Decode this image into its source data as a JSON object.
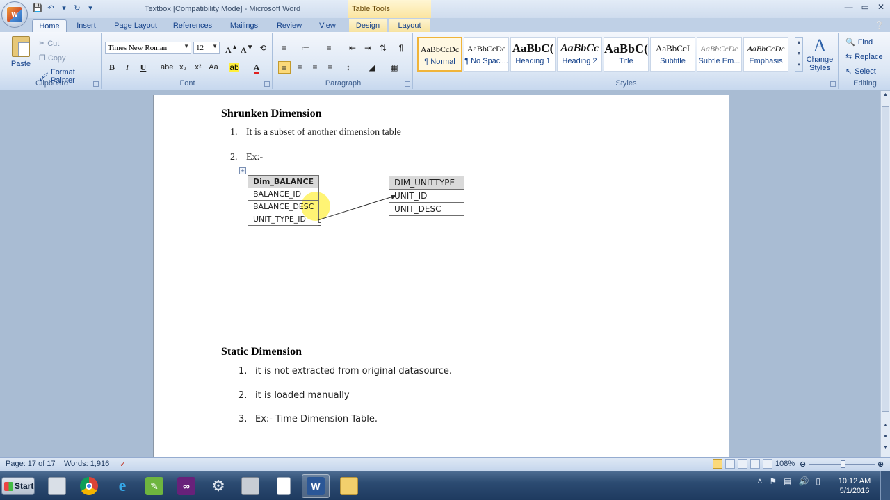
{
  "window": {
    "title": "Textbox [Compatibility Mode] - Microsoft Word",
    "contextual_tab_group": "Table Tools",
    "office_button_label": "W"
  },
  "tabs": [
    "Home",
    "Insert",
    "Page Layout",
    "References",
    "Mailings",
    "Review",
    "View",
    "Design",
    "Layout"
  ],
  "ribbon": {
    "clipboard": {
      "group_label": "Clipboard",
      "paste": "Paste",
      "cut": "Cut",
      "copy": "Copy",
      "format_painter": "Format Painter"
    },
    "font": {
      "group_label": "Font",
      "font_name": "Times New Roman",
      "font_size": "12",
      "bold": "B",
      "italic": "I",
      "underline": "U",
      "strike": "abe",
      "subscript": "x₂",
      "superscript": "x²",
      "change_case": "Aa"
    },
    "paragraph": {
      "group_label": "Paragraph"
    },
    "styles": {
      "group_label": "Styles",
      "items": [
        {
          "sample": "AaBbCcDc",
          "name": "¶ Normal"
        },
        {
          "sample": "AaBbCcDc",
          "name": "¶ No Spaci..."
        },
        {
          "sample": "AaBbC(",
          "name": "Heading 1"
        },
        {
          "sample": "AaBbCc",
          "name": "Heading 2"
        },
        {
          "sample": "AaBbC(",
          "name": "Title"
        },
        {
          "sample": "AaBbCcI",
          "name": "Subtitle"
        },
        {
          "sample": "AaBbCcDc",
          "name": "Subtle Em..."
        },
        {
          "sample": "AaBbCcDc",
          "name": "Emphasis"
        }
      ],
      "change_styles": "Change Styles"
    },
    "editing": {
      "group_label": "Editing",
      "find": "Find",
      "replace": "Replace",
      "select": "Select"
    }
  },
  "document": {
    "section1_heading": "Shrunken  Dimension",
    "section1_items": [
      "It is a subset of another dimension table",
      "Ex:-"
    ],
    "table1": {
      "header": "Dim_BALANCE",
      "rows": [
        "BALANCE_ID",
        "BALANCE_DESC",
        "UNIT_TYPE_ID"
      ]
    },
    "table2": {
      "header": "DIM_UNITTYPE",
      "rows": [
        "UNIT_ID",
        "UNIT_DESC"
      ]
    },
    "section2_heading": "Static Dimension",
    "section2_items": [
      "it is not extracted from original datasource.",
      "it is loaded manually",
      "Ex:- Time Dimension Table."
    ]
  },
  "statusbar": {
    "page": "Page: 17 of 17",
    "words": "Words: 1,916",
    "zoom": "108%",
    "zoom_level": 1.08
  },
  "taskbar": {
    "start": "Start",
    "time": "10:12 AM",
    "date": "5/1/2016"
  }
}
